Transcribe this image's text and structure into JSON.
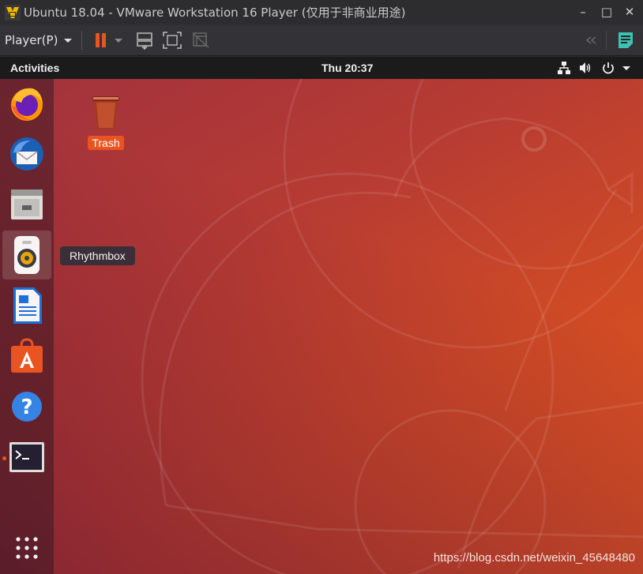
{
  "window": {
    "title": "Ubuntu 18.04 - VMware Workstation 16 Player (仅用于非商业用途)",
    "minimize_glyph": "–",
    "maximize_glyph": "□",
    "close_glyph": "✕"
  },
  "toolbar": {
    "player_menu": "Player(P)",
    "icons": [
      "pause-icon",
      "send-ctrl-alt-del-icon",
      "fullscreen-icon",
      "unity-icon",
      "back-arrows-icon",
      "message-log-icon"
    ],
    "accent": "#e95420"
  },
  "panel": {
    "activities": "Activities",
    "clock": "Thu 20:37",
    "tray_icons": [
      "network-icon",
      "volume-icon",
      "power-icon",
      "tray-menu-caret-icon"
    ]
  },
  "dock": {
    "items": [
      {
        "name": "firefox-icon"
      },
      {
        "name": "thunderbird-icon"
      },
      {
        "name": "files-icon"
      },
      {
        "name": "rhythmbox-icon"
      },
      {
        "name": "libreoffice-writer-icon"
      },
      {
        "name": "ubuntu-software-icon"
      },
      {
        "name": "help-icon"
      },
      {
        "name": "terminal-icon"
      }
    ],
    "tooltip": "Rhythmbox",
    "show_apps_icon": "show-applications-icon"
  },
  "desktop": {
    "trash_label": "Trash"
  },
  "watermark": "https://blog.csdn.net/weixin_45648480"
}
